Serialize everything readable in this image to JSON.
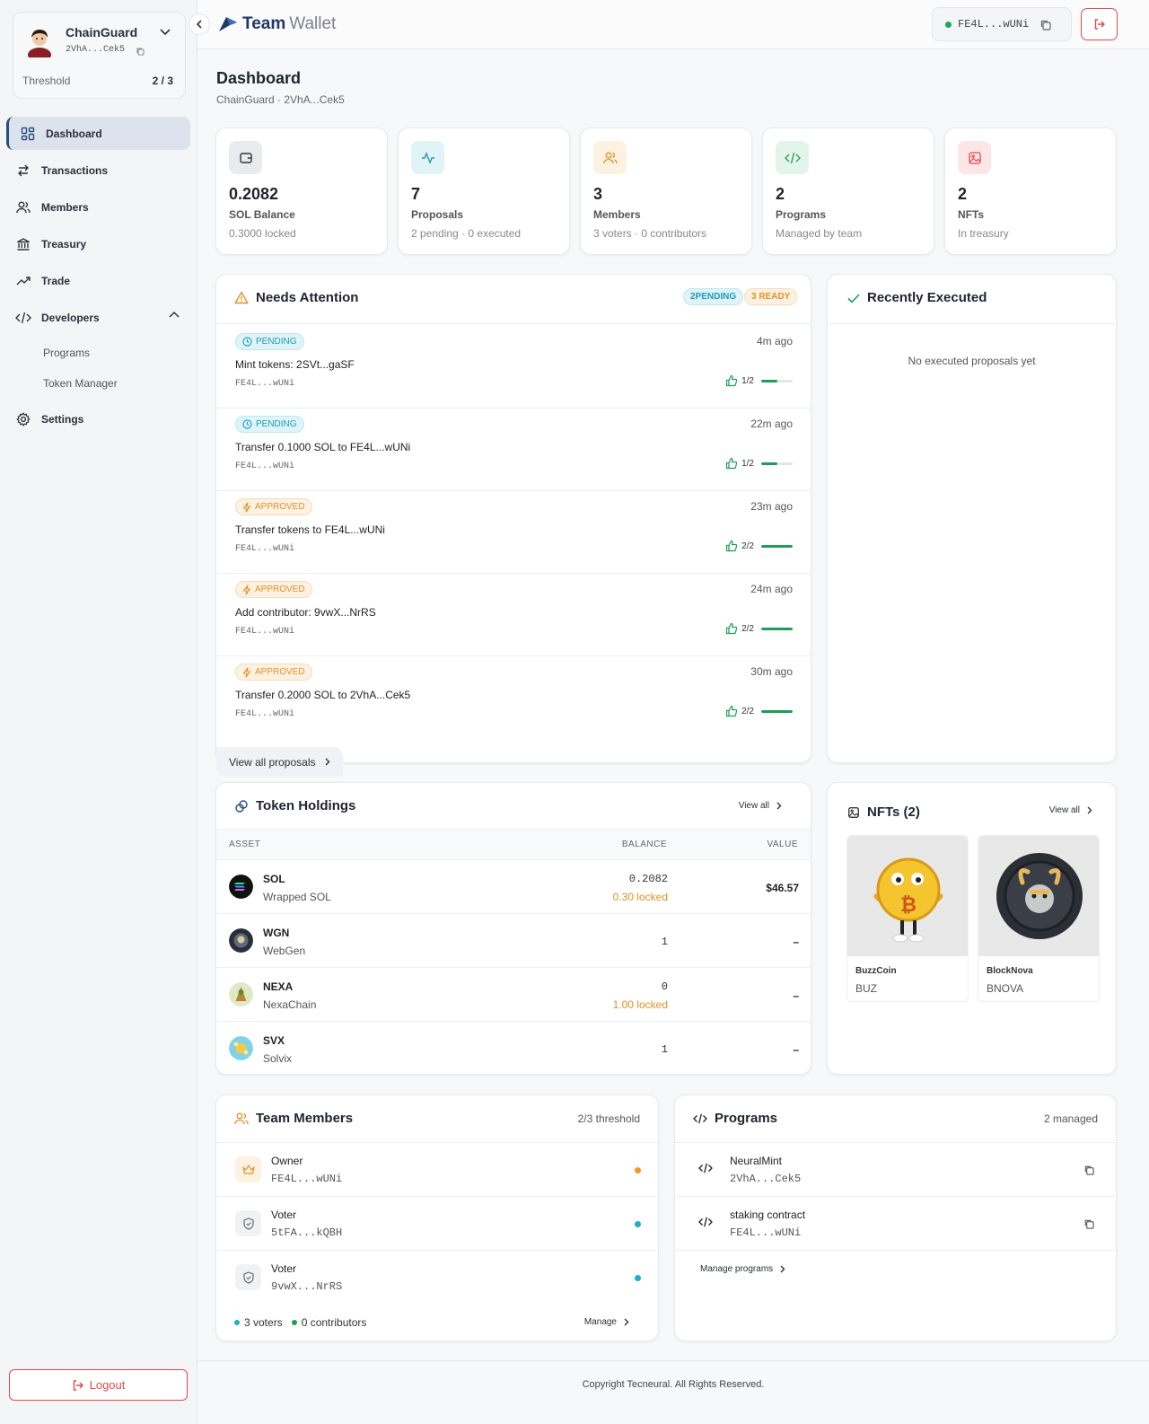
{
  "account": {
    "name": "ChainGuard",
    "address": "2VhA...Cek5",
    "threshold_label": "Threshold",
    "threshold_value": "2 / 3"
  },
  "nav": {
    "dashboard": "Dashboard",
    "transactions": "Transactions",
    "members": "Members",
    "treasury": "Treasury",
    "trade": "Trade",
    "developers": "Developers",
    "programs": "Programs",
    "token_manager": "Token Manager",
    "settings": "Settings"
  },
  "logout_label": "Logout",
  "brand": {
    "part1": "Team",
    "part2": "Wallet"
  },
  "wallet_address": "FE4L...wUNi",
  "page": {
    "title": "Dashboard",
    "subtitle": "ChainGuard · 2VhA...Cek5"
  },
  "stats": [
    {
      "value": "0.2082",
      "label": "SOL Balance",
      "sub": "0.3000 locked"
    },
    {
      "value": "7",
      "label": "Proposals",
      "sub": "2 pending · 0 executed"
    },
    {
      "value": "3",
      "label": "Members",
      "sub": "3 voters · 0 contributors"
    },
    {
      "value": "2",
      "label": "Programs",
      "sub": "Managed by team"
    },
    {
      "value": "2",
      "label": "NFTs",
      "sub": "In treasury"
    }
  ],
  "attention": {
    "title": "Needs Attention",
    "badge_pending": "2PENDING",
    "badge_ready": "3 READY",
    "proposals": [
      {
        "status": "PENDING",
        "time": "4m ago",
        "title": "Mint tokens: 2SVt...gaSF",
        "addr": "FE4L...wUNi",
        "votes": "1/2",
        "progress": 0.5
      },
      {
        "status": "PENDING",
        "time": "22m ago",
        "title": "Transfer 0.1000 SOL to FE4L...wUNi",
        "addr": "FE4L...wUNi",
        "votes": "1/2",
        "progress": 0.5
      },
      {
        "status": "APPROVED",
        "time": "23m ago",
        "title": "Transfer tokens to FE4L...wUNi",
        "addr": "FE4L...wUNi",
        "votes": "2/2",
        "progress": 1
      },
      {
        "status": "APPROVED",
        "time": "24m ago",
        "title": "Add contributor: 9vwX...NrRS",
        "addr": "FE4L...wUNi",
        "votes": "2/2",
        "progress": 1
      },
      {
        "status": "APPROVED",
        "time": "30m ago",
        "title": "Transfer 0.2000 SOL to 2VhA...Cek5",
        "addr": "FE4L...wUNi",
        "votes": "2/2",
        "progress": 1
      }
    ],
    "view_all": "View all proposals"
  },
  "recent": {
    "title": "Recently Executed",
    "empty": "No executed proposals yet"
  },
  "holdings": {
    "title": "Token Holdings",
    "view_all": "View all",
    "headers": {
      "asset": "ASSET",
      "balance": "BALANCE",
      "value": "VALUE"
    },
    "rows": [
      {
        "symbol": "SOL",
        "name": "Wrapped SOL",
        "balance": "0.2082",
        "locked": "0.30 locked",
        "value": "$46.57"
      },
      {
        "symbol": "WGN",
        "name": "WebGen",
        "balance": "1",
        "locked": "",
        "value": "–"
      },
      {
        "symbol": "NEXA",
        "name": "NexaChain",
        "balance": "0",
        "locked": "1.00 locked",
        "value": "–"
      },
      {
        "symbol": "SVX",
        "name": "Solvix",
        "balance": "1",
        "locked": "",
        "value": "–"
      }
    ]
  },
  "nfts": {
    "title": "NFTs (2)",
    "view_all": "View all",
    "items": [
      {
        "name": "BuzzCoin",
        "symbol": "BUZ"
      },
      {
        "name": "BlockNova",
        "symbol": "BNOVA"
      }
    ]
  },
  "team": {
    "title": "Team Members",
    "threshold": "2/3 threshold",
    "members": [
      {
        "role": "Owner",
        "addr": "FE4L...wUNi",
        "dot": "#f39a1e"
      },
      {
        "role": "Voter",
        "addr": "5tFA...kQBH",
        "dot": "#1ab0c9"
      },
      {
        "role": "Voter",
        "addr": "9vwX...NrRS",
        "dot": "#1ab0c9"
      }
    ],
    "voters": "3 voters",
    "contributors": "0 contributors",
    "manage": "Manage"
  },
  "programs": {
    "title": "Programs",
    "count": "2 managed",
    "items": [
      {
        "name": "NeuralMint",
        "addr": "2VhA...Cek5"
      },
      {
        "name": "staking contract",
        "addr": "FE4L...wUNi"
      }
    ],
    "manage": "Manage programs"
  },
  "footer": "Copyright Tecneural. All Rights Reserved.",
  "colors": {
    "accent": "#2b4c7e",
    "danger": "#e4494d",
    "success": "#1f9d55",
    "pending": "#1c9bb8",
    "approved": "#e39126"
  }
}
